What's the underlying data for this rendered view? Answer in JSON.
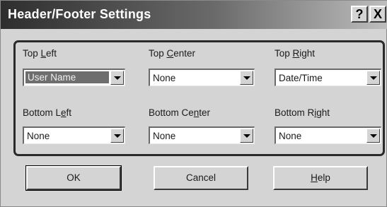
{
  "window": {
    "title": "Header/Footer Settings",
    "help_glyph": "?",
    "close_glyph": "X"
  },
  "fields": {
    "top_left": {
      "label_pre": "Top ",
      "label_key": "L",
      "label_post": "eft",
      "value": "User Name"
    },
    "top_center": {
      "label_pre": "Top ",
      "label_key": "C",
      "label_post": "enter",
      "value": "None"
    },
    "top_right": {
      "label_pre": "Top ",
      "label_key": "R",
      "label_post": "ight",
      "value": "Date/Time"
    },
    "bottom_left": {
      "label_pre": "Bottom L",
      "label_key": "e",
      "label_post": "ft",
      "value": "None"
    },
    "bottom_center": {
      "label_pre": "Bottom Ce",
      "label_key": "n",
      "label_post": "ter",
      "value": "None"
    },
    "bottom_right": {
      "label_pre": "Bottom R",
      "label_key": "i",
      "label_post": "ght",
      "value": "None"
    }
  },
  "buttons": {
    "ok": "OK",
    "cancel": "Cancel",
    "help_key": "H",
    "help_rest": "elp"
  },
  "colors": {
    "dialog_bg": "#d4d4d4",
    "titlebar_dark": "#2e2e2e",
    "selection": "#6e6e6e"
  }
}
